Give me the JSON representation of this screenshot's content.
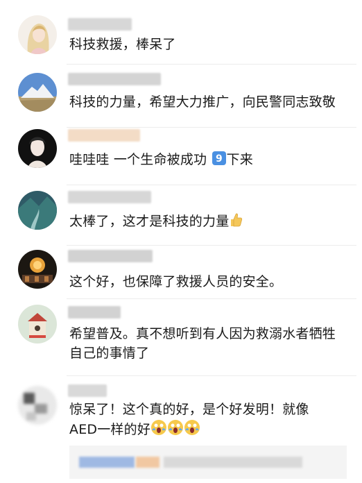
{
  "comments": [
    {
      "text": "科技救援，棒呆了",
      "avatar": "avatar-girl",
      "name_color": "#d7d7d7"
    },
    {
      "text": "科技的力量，希望大力推广，向民警同志致敬",
      "avatar": "avatar-mountain",
      "name_color": "#d4d4d4"
    },
    {
      "text": "哇哇哇 一个生命被成功",
      "suffix": "下来",
      "badge_number": "9",
      "avatar": "avatar-portrait",
      "name_color": "#f3dcc6"
    },
    {
      "text": "太棒了，这才是科技的力量",
      "emoji": "thumbs-up-emoji",
      "avatar": "avatar-river",
      "name_color": "#d7d7d7"
    },
    {
      "text": "这个好，也保障了救援人员的安全。",
      "avatar": "avatar-lantern",
      "name_color": "#d2d2d2"
    },
    {
      "text": "希望普及。真不想听到有人因为救溺水者牺牲\n自己的事情了",
      "avatar": "avatar-birdhouse",
      "name_color": "#d2d2d2"
    },
    {
      "text": "惊呆了！这个真的好，是个好发明！就像\nAED一样的好",
      "emoji": "scream-face-emoji",
      "emoji_count": 3,
      "avatar": "avatar-blurred",
      "name_color": "#d9d9d9"
    }
  ],
  "colors": {
    "badge_blue": "#4a90e2",
    "thumb_yellow": "#f4c75a",
    "divider": "#ececec"
  }
}
